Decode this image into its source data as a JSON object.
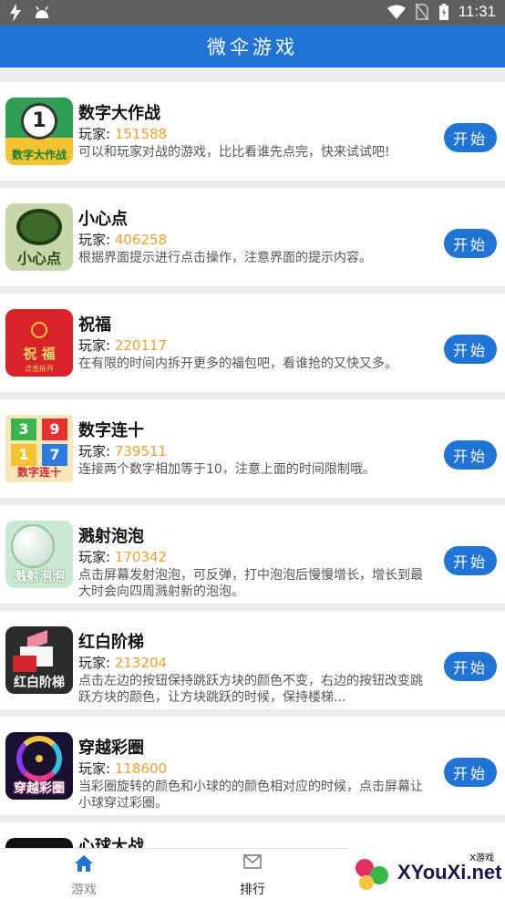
{
  "status": {
    "time": "11:31"
  },
  "header": {
    "title": "微伞游戏"
  },
  "games": [
    {
      "name": "数字大作战",
      "players_label": "玩家: ",
      "players": "151588",
      "desc": "可以和玩家对战的游戏，比比看谁先点完，快来试试吧!",
      "start": "开始",
      "thumb_text": "数字大作战",
      "thumb_num": "1"
    },
    {
      "name": "小心点",
      "players_label": "玩家: ",
      "players": "406258",
      "desc": "根据界面提示进行点击操作，注意界面的提示内容。",
      "start": "开始",
      "thumb_text": "小心点"
    },
    {
      "name": "祝福",
      "players_label": "玩家: ",
      "players": "220117",
      "desc": "在有限的时间内拆开更多的福包吧，看谁抢的又快又多。",
      "start": "开始",
      "thumb_text": "祝 福",
      "thumb_sub": "点击拆开"
    },
    {
      "name": "数字连十",
      "players_label": "玩家: ",
      "players": "739511",
      "desc": "连接两个数字相加等于10，注意上面的时间限制哦。",
      "start": "开始",
      "thumb_text": "数字连十",
      "thumb_nums": [
        "3",
        "9",
        "1",
        "7"
      ]
    },
    {
      "name": "溅射泡泡",
      "players_label": "玩家: ",
      "players": "170342",
      "desc": "点击屏幕发射泡泡，可反弹，打中泡泡后慢慢增长，增长到最大时会向四周溅射新的泡泡。",
      "start": "开始",
      "thumb_text": "溅射泡泡"
    },
    {
      "name": "红白阶梯",
      "players_label": "玩家: ",
      "players": "213204",
      "desc": "点击左边的按钮保持跳跃方块的颜色不变，右边的按钮改变跳跃方块的颜色，让方块跳跃的时候，保持楼梯...",
      "start": "开始",
      "thumb_text": "红白阶梯"
    },
    {
      "name": "穿越彩圈",
      "players_label": "玩家: ",
      "players": "118600",
      "desc": "当彩圈旋转的颜色和小球的的颜色相对应的时候，点击屏幕让小球穿过彩圈。",
      "start": "开始",
      "thumb_text": "穿越彩圈"
    },
    {
      "name": "心球大战",
      "players_label": "",
      "players": "",
      "desc": "",
      "start": ""
    }
  ],
  "tabs": [
    {
      "label": "游戏",
      "icon": "home-icon",
      "active": true
    },
    {
      "label": "排行",
      "icon": "mail-icon",
      "active": false
    }
  ],
  "watermark": {
    "text": "XYouXi.net",
    "small": "X游戏"
  },
  "colors": {
    "primary": "#1f74d6",
    "accent": "#f0a030"
  }
}
